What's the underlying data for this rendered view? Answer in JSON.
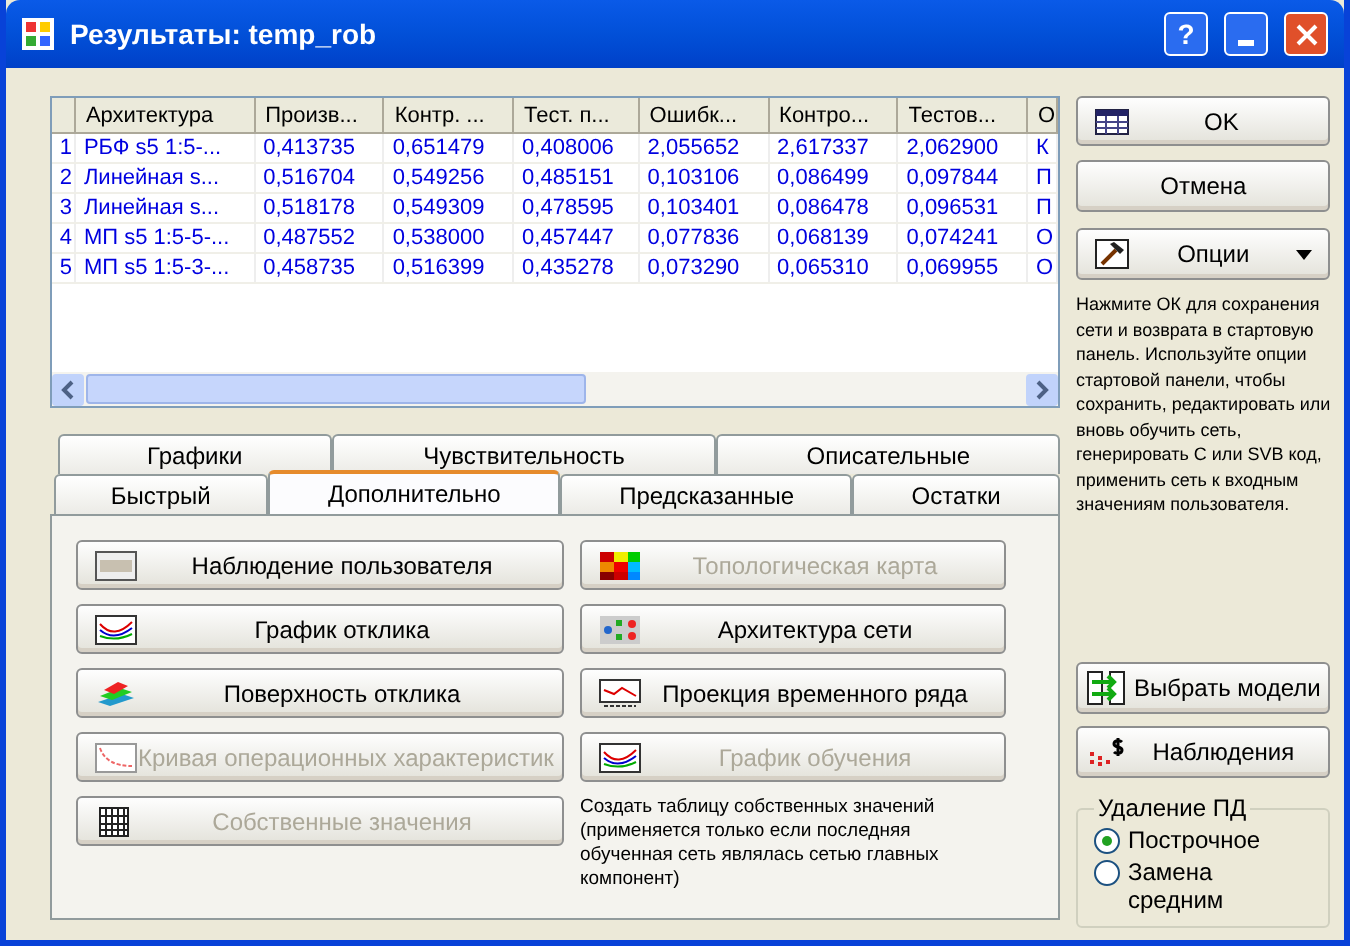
{
  "window": {
    "title": "Результаты: temp_rob",
    "help_button": "?"
  },
  "table": {
    "columns": [
      "Архитектура",
      "Произв...",
      "Контр. ...",
      "Тест. п...",
      "Ошибк...",
      "Контро...",
      "Тестов...",
      "О"
    ],
    "rows": [
      {
        "number": "1",
        "cells": [
          "РБФ s5 1:5-...",
          "0,413735",
          "0,651479",
          "0,408006",
          "2,055652",
          "2,617337",
          "2,062900",
          "К"
        ]
      },
      {
        "number": "2",
        "cells": [
          "Линейная s...",
          "0,516704",
          "0,549256",
          "0,485151",
          "0,103106",
          "0,086499",
          "0,097844",
          "П"
        ]
      },
      {
        "number": "3",
        "cells": [
          "Линейная s...",
          "0,518178",
          "0,549309",
          "0,478595",
          "0,103401",
          "0,086478",
          "0,096531",
          "П"
        ]
      },
      {
        "number": "4",
        "cells": [
          "МП s5 1:5-5-...",
          "0,487552",
          "0,538000",
          "0,457447",
          "0,077836",
          "0,068139",
          "0,074241",
          "О"
        ]
      },
      {
        "number": "5",
        "cells": [
          "МП s5 1:5-3-...",
          "0,458735",
          "0,516399",
          "0,435278",
          "0,073290",
          "0,065310",
          "0,069955",
          "О"
        ]
      }
    ]
  },
  "tabs": {
    "back_row": [
      {
        "label": "Графики",
        "selected": false
      },
      {
        "label": "Чувствительность",
        "selected": false
      },
      {
        "label": "Описательные",
        "selected": false
      }
    ],
    "front_row": [
      {
        "label": "Быстрый",
        "selected": false
      },
      {
        "label": "Дополнительно",
        "selected": true
      },
      {
        "label": "Предсказанные",
        "selected": false
      },
      {
        "label": "Остатки",
        "selected": false
      }
    ]
  },
  "panel": {
    "left_buttons": [
      {
        "label": "Наблюдение пользователя",
        "kind": "user",
        "disabled": false
      },
      {
        "label": "График отклика",
        "kind": "chart",
        "disabled": false
      },
      {
        "label": "Поверхность отклика",
        "kind": "surface",
        "disabled": false
      },
      {
        "label": "Кривая операционных характеристик",
        "kind": "curve",
        "disabled": true
      },
      {
        "label": "Собственные значения",
        "kind": "grid",
        "disabled": true
      }
    ],
    "right_buttons": [
      {
        "label": "Топологическая карта",
        "kind": "map",
        "disabled": true
      },
      {
        "label": "Архитектура сети",
        "kind": "network",
        "disabled": false
      },
      {
        "label": "Проекция временного ряда",
        "kind": "series",
        "disabled": false
      },
      {
        "label": "График обучения",
        "kind": "chart",
        "disabled": true
      }
    ],
    "description": "Создать таблицу собственных значений (применяется только если последняя обученная сеть являлась сетью главных компонент)"
  },
  "side": {
    "ok": "OK",
    "cancel": "Отмена",
    "options": "Опции",
    "help_text": "Нажмите ОК для сохранения сети и возврата в стартовую панель. Используйте опции стартовой панели, чтобы сохранить, редактировать или вновь обучить сеть, генерировать C или SVB код, применить сеть к входным значениям пользователя.",
    "select_models": "Выбрать модели",
    "observations": "Наблюдения",
    "group": {
      "title": "Удаление ПД",
      "options": [
        {
          "label": "Построчное",
          "selected": true
        },
        {
          "label": "Замена средним",
          "selected": false
        }
      ]
    }
  }
}
